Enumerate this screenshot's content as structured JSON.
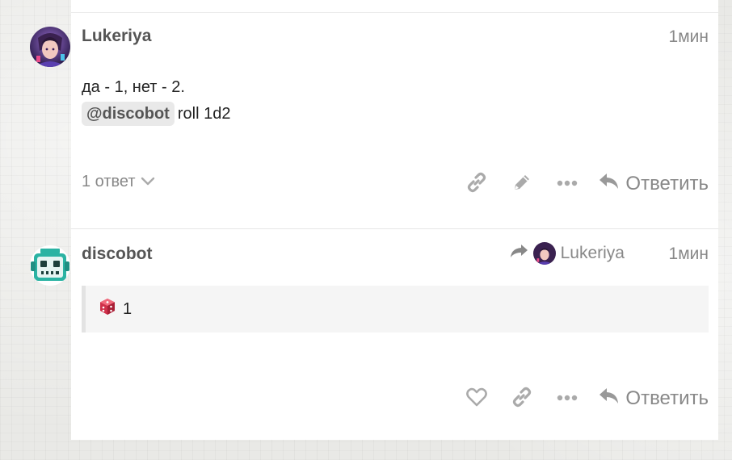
{
  "posts": [
    {
      "username": "Lukeriya",
      "time": "1мин",
      "lines": [
        "да - 1, нет - 2."
      ],
      "mention": "@discobot",
      "command": "roll 1d2",
      "replies_label": "1 ответ",
      "reply_label": "Ответить"
    },
    {
      "username": "discobot",
      "time": "1мин",
      "reply_to_user": "Lukeriya",
      "quote_value": "1",
      "reply_label": "Ответить"
    }
  ],
  "icons": {
    "link": "link-icon",
    "edit": "pencil-icon",
    "more": "ellipsis-icon",
    "reply": "reply-icon",
    "like": "heart-icon",
    "dice": "dice-icon",
    "chevron": "chevron-down-icon"
  },
  "colors": {
    "accent_gray": "#999999",
    "bot_teal": "#2bb3a3",
    "dice_red": "#d0304a"
  }
}
